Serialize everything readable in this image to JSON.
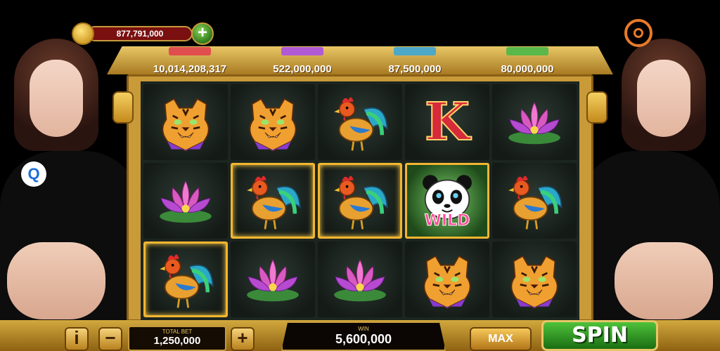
{
  "balance": {
    "amount": "877,791,000",
    "add_label": "+"
  },
  "jackpots": [
    {
      "value": "10,014,208,317",
      "tag_color": "#e04e4e"
    },
    {
      "value": "522,000,000",
      "tag_color": "#b05ad6"
    },
    {
      "value": "87,500,000",
      "tag_color": "#4ea8c8"
    },
    {
      "value": "80,000,000",
      "tag_color": "#5ab84a"
    }
  ],
  "reels": [
    [
      "tiger",
      "tiger",
      "rooster",
      "k",
      "lotus"
    ],
    [
      "lotus",
      "rooster",
      "rooster",
      "panda-wild",
      "rooster"
    ],
    [
      "rooster",
      "lotus",
      "lotus",
      "tiger",
      "tiger"
    ]
  ],
  "winning_cells": [
    "1-1",
    "1-2",
    "1-3",
    "2-0"
  ],
  "symbols": {
    "k_label": "K",
    "wild_label": "WILD"
  },
  "controls": {
    "info_label": "i",
    "minus_label": "−",
    "plus_label": "+",
    "total_bet_label": "TOTAL BET",
    "total_bet_value": "1,250,000",
    "win_label": "WIN",
    "win_value": "5,600,000",
    "max_label": "MAX",
    "spin_label": "SPIN"
  },
  "presenters": {
    "badge_label": "Q"
  },
  "colors": {
    "gold": "#c99a38",
    "wild_pink": "#ff4aa0",
    "spin_green": "#2f9a20"
  }
}
